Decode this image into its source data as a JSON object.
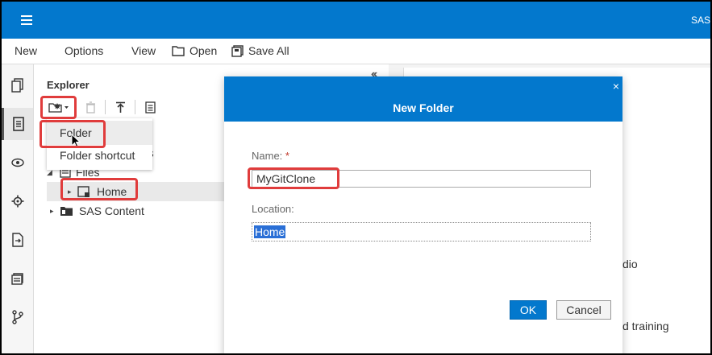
{
  "topbar": {
    "app_title": "SAS"
  },
  "menubar": {
    "new": "New",
    "options": "Options",
    "view": "View",
    "open": "Open",
    "save_all": "Save All"
  },
  "explorer": {
    "title": "Explorer",
    "collapse": "«",
    "tree": {
      "files": "Files",
      "home": "Home",
      "sas_content": "SAS Content",
      "shortcuts_partial": "uts"
    }
  },
  "dropdown": {
    "folder": "Folder",
    "folder_shortcut": "Folder shortcut"
  },
  "background": {
    "text1": "dio",
    "text2": "d training"
  },
  "dialog": {
    "title": "New Folder",
    "close": "×",
    "name_label": "Name:",
    "required_mark": "*",
    "name_value": "MyGitClone",
    "location_label": "Location:",
    "location_value": "Home",
    "ok": "OK",
    "cancel": "Cancel"
  },
  "colors": {
    "brand_blue": "#0378cd",
    "highlight_red": "#e03c3c",
    "selection_blue": "#2a6fd6"
  }
}
